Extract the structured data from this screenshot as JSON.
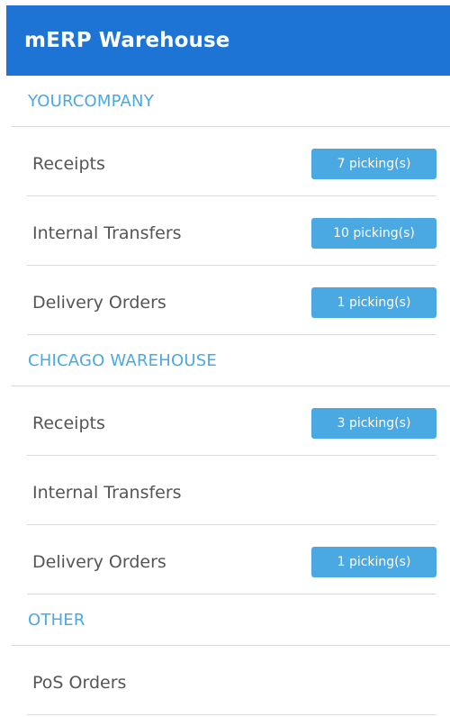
{
  "app": {
    "title": "mERP Warehouse"
  },
  "colors": {
    "header_bg": "#1e74d4",
    "accent": "#4aa8e3",
    "divider": "#dcdcdc",
    "text": "#555555"
  },
  "sections": [
    {
      "name": "YOURCOMPANY",
      "items": [
        {
          "label": "Receipts",
          "badge": "7 picking(s)"
        },
        {
          "label": "Internal Transfers",
          "badge": "10 picking(s)"
        },
        {
          "label": "Delivery Orders",
          "badge": "1 picking(s)"
        }
      ]
    },
    {
      "name": "CHICAGO WAREHOUSE",
      "items": [
        {
          "label": "Receipts",
          "badge": "3 picking(s)"
        },
        {
          "label": "Internal Transfers",
          "badge": ""
        },
        {
          "label": "Delivery Orders",
          "badge": "1 picking(s)"
        }
      ]
    },
    {
      "name": "OTHER",
      "items": [
        {
          "label": "PoS Orders",
          "badge": ""
        }
      ]
    }
  ]
}
